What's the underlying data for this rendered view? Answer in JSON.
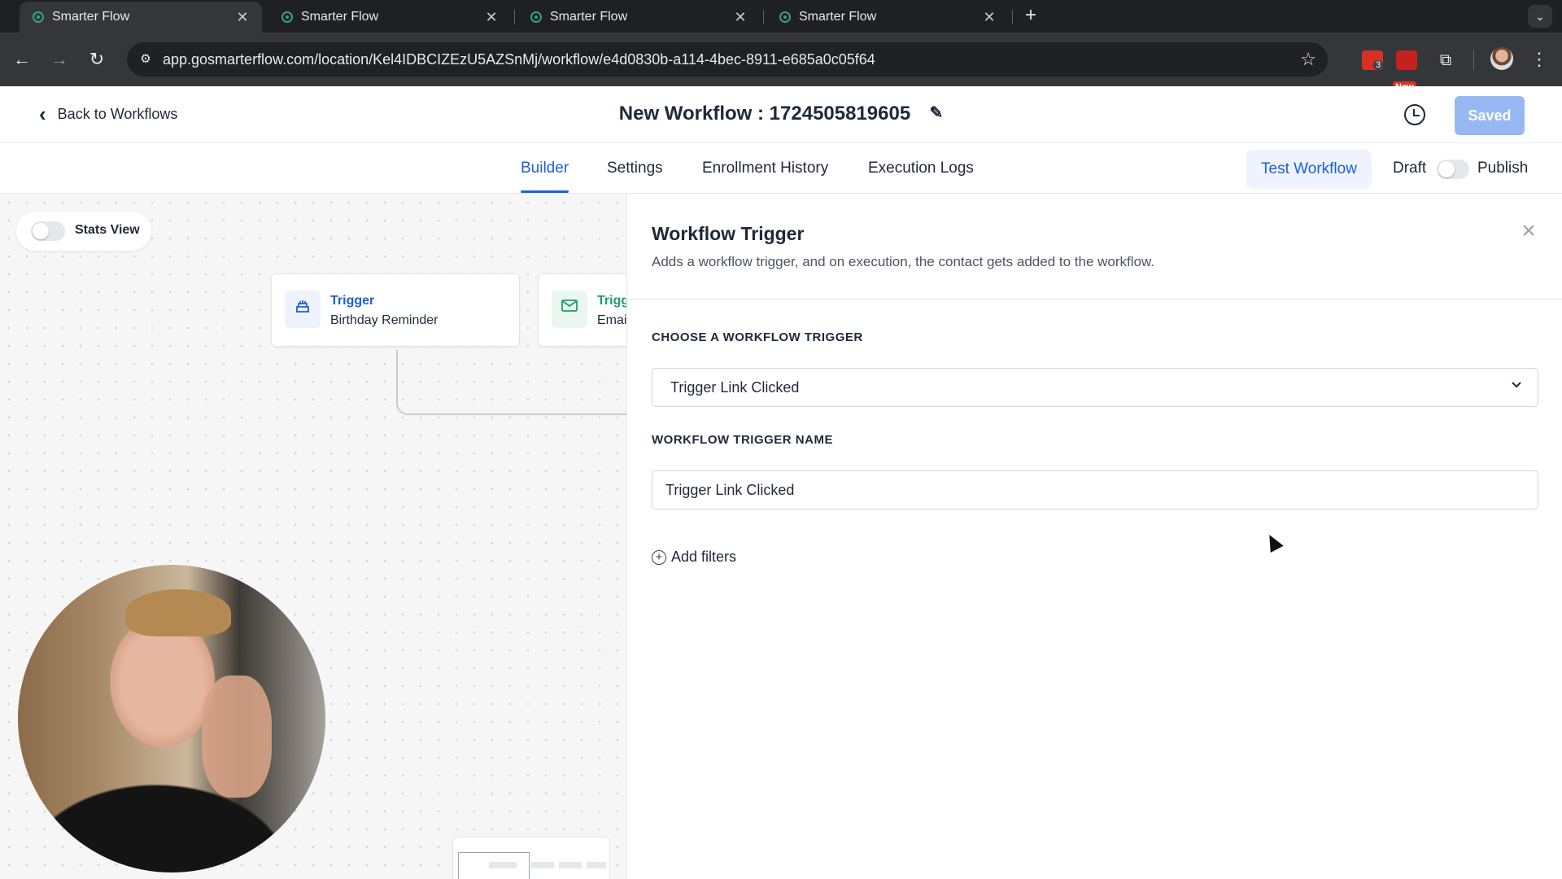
{
  "browser": {
    "tabs": [
      {
        "title": "Smarter Flow",
        "active": true
      },
      {
        "title": "Smarter Flow",
        "active": false
      },
      {
        "title": "Smarter Flow",
        "active": false
      },
      {
        "title": "Smarter Flow",
        "active": false
      }
    ],
    "url": "app.gosmarterflow.com/location/Kel4IDBCIZEzU5AZSnMj/workflow/e4d0830b-a114-4bec-8911-e685a0c05f64",
    "extension_badge": "3",
    "extension_new_label": "New"
  },
  "header": {
    "back_label": "Back to Workflows",
    "workflow_title": "New Workflow : 1724505819605",
    "saved_label": "Saved"
  },
  "tabs": {
    "builder": "Builder",
    "settings": "Settings",
    "enrollment_history": "Enrollment History",
    "execution_logs": "Execution Logs",
    "active": "Builder"
  },
  "actions": {
    "test_workflow": "Test Workflow",
    "draft": "Draft",
    "publish": "Publish",
    "published": false
  },
  "canvas": {
    "stats_view_label": "Stats View",
    "stats_view_on": false,
    "nodes": [
      {
        "kind": "Trigger",
        "name": "Birthday Reminder",
        "icon": "cake-icon"
      },
      {
        "kind": "Trigg",
        "name": "Email",
        "icon": "mail-icon"
      }
    ]
  },
  "panel": {
    "title": "Workflow Trigger",
    "description": "Adds a workflow trigger, and on execution, the contact gets added to the workflow.",
    "choose_label": "CHOOSE A WORKFLOW TRIGGER",
    "selected_trigger": "Trigger Link Clicked",
    "name_label": "WORKFLOW TRIGGER NAME",
    "trigger_name_value": "Trigger Link Clicked",
    "add_filters": "Add filters"
  },
  "colors": {
    "accent": "#1e5fd8",
    "saved_button": "#97b8f3",
    "trigger_node": "#1e5fd8",
    "email_node": "#1f9d6b"
  }
}
